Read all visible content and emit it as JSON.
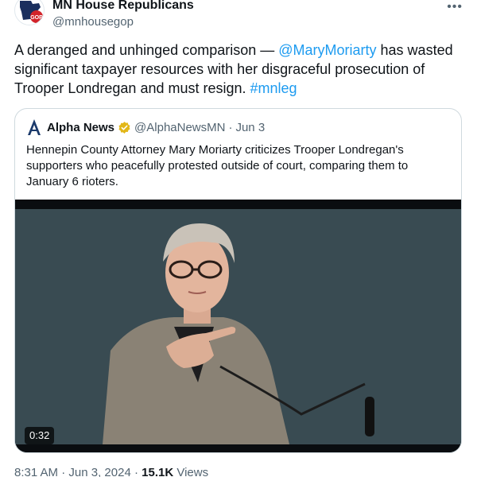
{
  "author": {
    "display_name": "MN House Republicans",
    "handle": "@mnhousegop",
    "avatar_text": "GOP"
  },
  "tweet": {
    "text_before": "A deranged and unhinged comparison — ",
    "mention": "@MaryMoriarty",
    "text_middle": " has wasted significant taxpayer resources with her disgraceful prosecution of Trooper Londregan and must resign. ",
    "hashtag": "#mnleg"
  },
  "quote": {
    "display_name": "Alpha News",
    "handle": "@AlphaNewsMN",
    "separator": "·",
    "date": "Jun 3",
    "text": "Hennepin County Attorney Mary Moriarty criticizes Trooper Londregan's supporters who peacefully protested outside of court, comparing them to January 6 rioters.",
    "video_duration": "0:32"
  },
  "meta": {
    "time": "8:31 AM",
    "sep1": "·",
    "date": "Jun 3, 2024",
    "sep2": "·",
    "views_count": "15.1K",
    "views_label": "Views"
  },
  "colors": {
    "link": "#1d9bf0",
    "verified_gold": "#e2b719",
    "muted": "#536471"
  },
  "icons": {
    "more": "more-horizontal-icon",
    "verified": "verified-badge-icon",
    "logo": "alpha-news-logo"
  }
}
